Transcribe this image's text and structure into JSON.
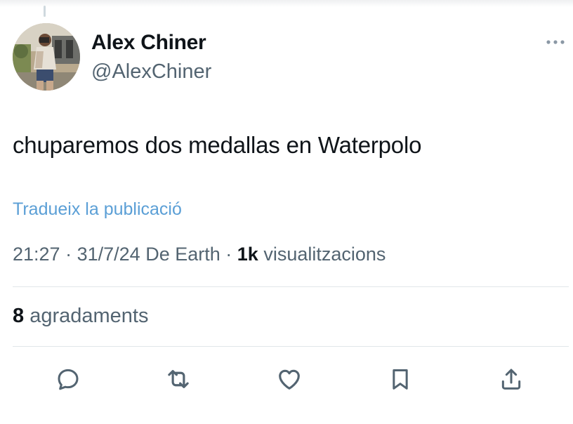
{
  "author": {
    "display_name": "Alex Chiner",
    "handle": "@AlexChiner"
  },
  "tweet": {
    "text": "chuparemos dos medallas en Waterpolo",
    "translate_label": "Tradueix la publicació"
  },
  "meta": {
    "time": "21:27",
    "date": "31/7/24",
    "source": "De Earth",
    "views_count": "1k",
    "views_label": "visualitzacions"
  },
  "stats": {
    "likes_count": "8",
    "likes_label": "agradaments"
  },
  "icons": {
    "more": "more-horizontal-icon",
    "reply": "reply-icon",
    "retweet": "retweet-icon",
    "like": "heart-icon",
    "bookmark": "bookmark-icon",
    "share": "share-icon"
  },
  "colors": {
    "text": "#0f1419",
    "secondary": "#536471",
    "link": "#5b9fd6",
    "divider": "#e1e6ea"
  }
}
